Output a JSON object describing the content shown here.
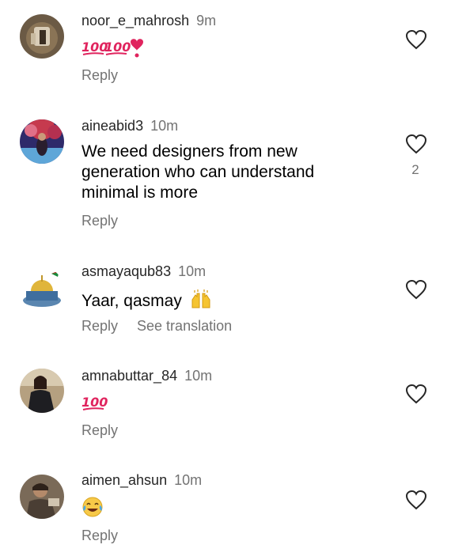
{
  "comments": [
    {
      "username": "noor_e_mahrosh",
      "time": "9m",
      "emojis": [
        "hundred-points-icon",
        "hundred-points-icon",
        "heart-exclamation-icon"
      ],
      "reply_label": "Reply"
    },
    {
      "username": "aineabid3",
      "time": "10m",
      "text_lines": [
        "We need designers from new",
        "generation who can understand",
        "minimal is more"
      ],
      "likes": "2",
      "reply_label": "Reply"
    },
    {
      "username": "asmayaqub83",
      "time": "10m",
      "text": "Yaar, qasmay",
      "text_emoji": "raising-hands-icon",
      "reply_label": "Reply",
      "translate_label": "See translation"
    },
    {
      "username": "amnabuttar_84",
      "time": "10m",
      "emojis": [
        "hundred-points-icon"
      ],
      "reply_label": "Reply"
    },
    {
      "username": "aimen_ahsun",
      "time": "10m",
      "emojis": [
        "tears-of-joy-icon"
      ],
      "reply_label": "Reply"
    }
  ],
  "colors": {
    "username": "#262626",
    "secondary": "#737373",
    "emoji_red": "#e0245e",
    "heart_outline": "#262626"
  }
}
